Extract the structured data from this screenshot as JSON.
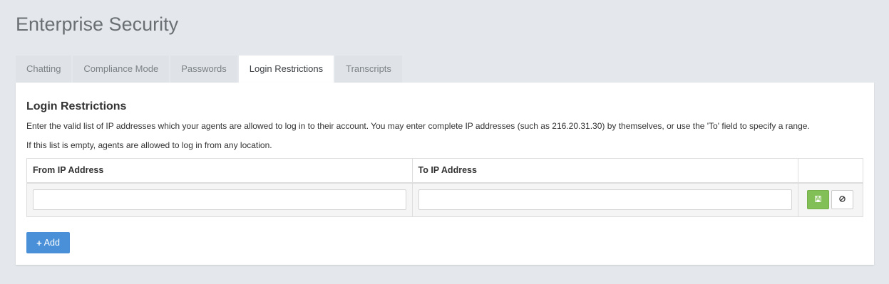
{
  "page": {
    "title": "Enterprise Security"
  },
  "tabs": [
    {
      "label": "Chatting",
      "active": false
    },
    {
      "label": "Compliance Mode",
      "active": false
    },
    {
      "label": "Passwords",
      "active": false
    },
    {
      "label": "Login Restrictions",
      "active": true
    },
    {
      "label": "Transcripts",
      "active": false
    }
  ],
  "section": {
    "title": "Login Restrictions",
    "description_1": "Enter the valid list of IP addresses which your agents are allowed to log in to their account. You may enter complete IP addresses (such as 216.20.31.30) by themselves, or use the 'To' field to specify a range.",
    "description_2": "If this list is empty, agents are allowed to log in from any location."
  },
  "table": {
    "columns": [
      "From IP Address",
      "To IP Address",
      ""
    ],
    "rows": [
      {
        "from_value": "",
        "to_value": ""
      }
    ]
  },
  "buttons": {
    "save_icon": "floppy-disk-icon",
    "cancel_icon": "ban-icon",
    "add_label": "Add",
    "add_icon": "plus-icon"
  },
  "colors": {
    "background": "#e4e8ec",
    "save_button": "#82bf56",
    "add_button": "#4a90d9"
  }
}
